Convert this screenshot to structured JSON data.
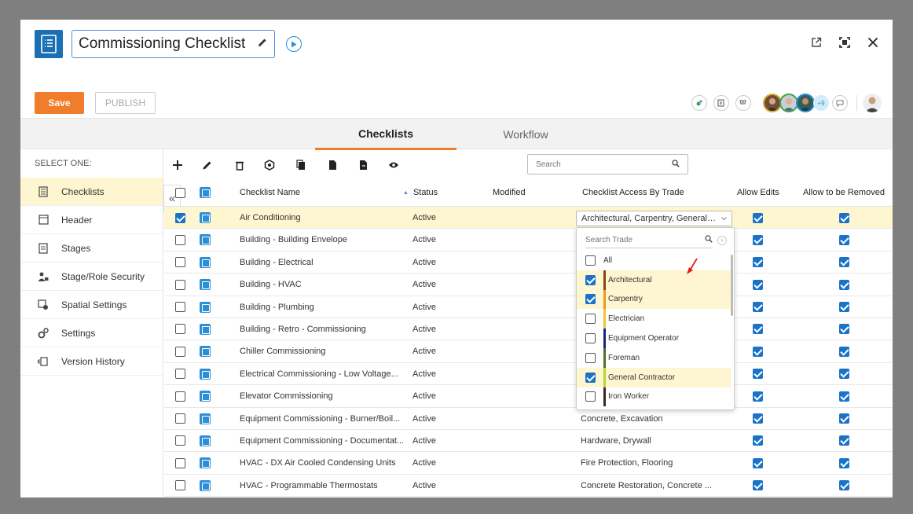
{
  "title": "Commissioning Checklist",
  "actions": {
    "save": "Save",
    "publish": "PUBLISH",
    "avatar_more": "+9"
  },
  "tabs": [
    {
      "label": "Checklists",
      "active": true
    },
    {
      "label": "Workflow",
      "active": false
    }
  ],
  "sidebar": {
    "heading": "SELECT ONE:",
    "items": [
      {
        "label": "Checklists",
        "icon": "checklist-icon",
        "active": true
      },
      {
        "label": "Header",
        "icon": "header-icon"
      },
      {
        "label": "Stages",
        "icon": "stages-icon"
      },
      {
        "label": "Stage/Role Security",
        "icon": "security-icon"
      },
      {
        "label": "Spatial Settings",
        "icon": "spatial-icon"
      },
      {
        "label": "Settings",
        "icon": "gears-icon"
      },
      {
        "label": "Version History",
        "icon": "history-icon"
      }
    ]
  },
  "search": {
    "placeholder": "Search"
  },
  "columns": {
    "name": "Checklist Name",
    "status": "Status",
    "modified": "Modified",
    "access": "Checklist Access By Trade",
    "allow_edits": "Allow Edits",
    "allow_removed": "Allow to be Removed"
  },
  "rows": [
    {
      "name": "Air Conditioning",
      "status": "Active",
      "access": "",
      "selected": true
    },
    {
      "name": "Building - Building Envelope",
      "status": "Active",
      "access": ""
    },
    {
      "name": "Building - Electrical",
      "status": "Active",
      "access": ""
    },
    {
      "name": "Building - HVAC",
      "status": "Active",
      "access": ""
    },
    {
      "name": "Building - Plumbing",
      "status": "Active",
      "access": ""
    },
    {
      "name": "Building - Retro - Commissioning",
      "status": "Active",
      "access": ""
    },
    {
      "name": "Chiller Commissioning",
      "status": "Active",
      "access": ""
    },
    {
      "name": "Electrical Commissioning - Low Voltage...",
      "status": "Active",
      "access": ""
    },
    {
      "name": "Elevator Commissioning",
      "status": "Active",
      "access": ""
    },
    {
      "name": "Equipment Commissioning - Burner/Boil...",
      "status": "Active",
      "access": "Concrete, Excavation"
    },
    {
      "name": "Equipment Commissioning - Documentat...",
      "status": "Active",
      "access": "Hardware, Drywall"
    },
    {
      "name": "HVAC - DX Air Cooled Condensing Units",
      "status": "Active",
      "access": "Fire Protection, Flooring"
    },
    {
      "name": "HVAC - Programmable Thermostats",
      "status": "Active",
      "access": "Concrete Restoration, Concrete ..."
    }
  ],
  "trade_select": {
    "value": "Architectural, Carpentry, General C..."
  },
  "trade_dropdown": {
    "search_placeholder": "Search Trade",
    "items": [
      {
        "label": "All",
        "checked": false,
        "color": ""
      },
      {
        "label": "Architectural",
        "checked": true,
        "color": "#8b4513"
      },
      {
        "label": "Carpentry",
        "checked": true,
        "color": "#e69a1e"
      },
      {
        "label": "Electrician",
        "checked": false,
        "color": "#f4c430"
      },
      {
        "label": "Equipment Operator",
        "checked": false,
        "color": "#1a237e"
      },
      {
        "label": "Foreman",
        "checked": false,
        "color": "#556b2f"
      },
      {
        "label": "General Contractor",
        "checked": true,
        "color": "#b8d432"
      },
      {
        "label": "Iron Worker",
        "checked": false,
        "color": "#3e2723"
      }
    ]
  }
}
